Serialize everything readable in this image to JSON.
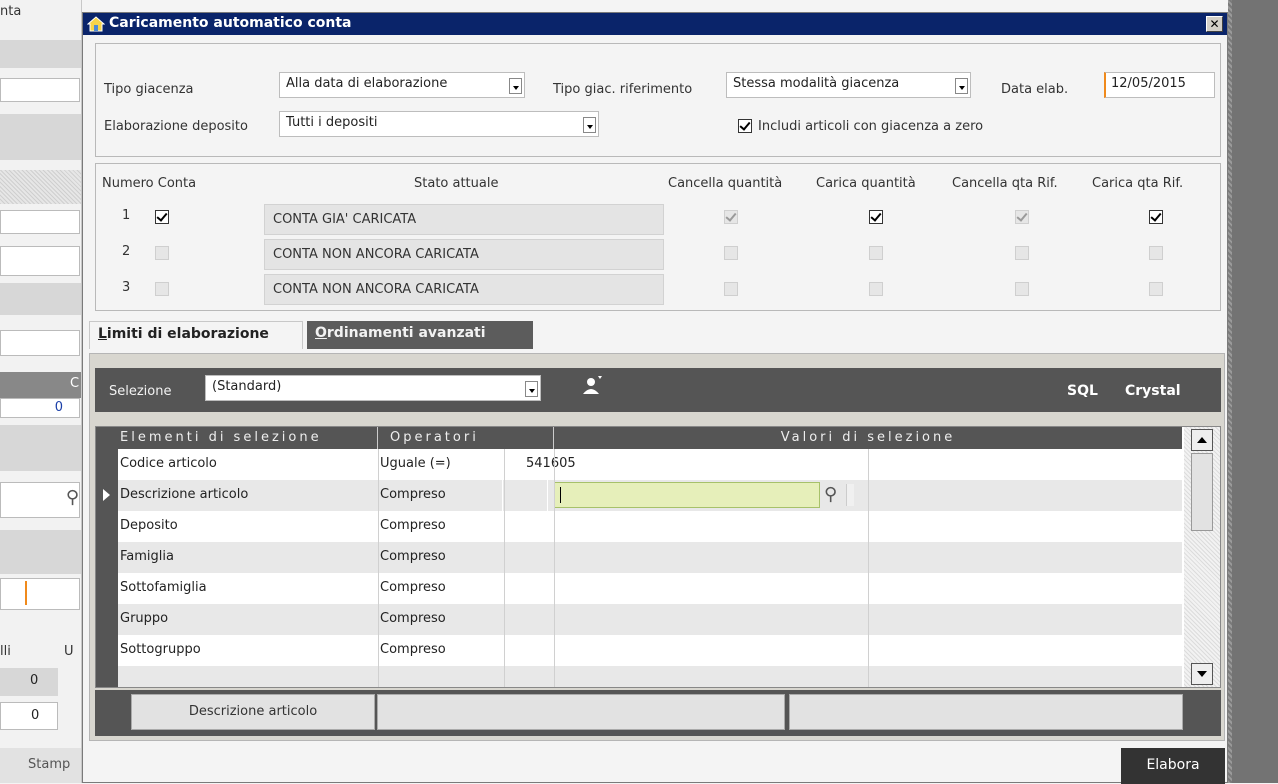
{
  "background": {
    "left_title_fragment": "nta",
    "left_value_zero": "0",
    "left_col_c": "C",
    "left_col_li": "lli",
    "left_col_u": "U",
    "row_zero_1": "0",
    "row_zero_2": "0",
    "stamp_label": "Stamp"
  },
  "dialog": {
    "title": "Caricamento automatico conta",
    "close_label": "✕",
    "close_icon": "close-icon",
    "app_icon": "home-icon"
  },
  "params": {
    "tipo_giacenza_label": "Tipo giacenza",
    "tipo_giacenza_value": "Alla data di elaborazione",
    "tipo_giac_rif_label": "Tipo giac. riferimento",
    "tipo_giac_rif_value": "Stessa modalità giacenza",
    "data_elab_label": "Data elab.",
    "data_elab_value": "12/05/2015",
    "elab_deposito_label": "Elaborazione deposito",
    "elab_deposito_value": "Tutti i depositi",
    "includi_label": "Includi articoli con giacenza a zero",
    "includi_checked": true
  },
  "conte": {
    "headers": {
      "numero": "Numero Conta",
      "stato": "Stato attuale",
      "cancella_qta": "Cancella quantità",
      "carica_qta": "Carica quantità",
      "cancella_rif": "Cancella qta Rif.",
      "carica_rif": "Carica qta Rif."
    },
    "rows": [
      {
        "num": "1",
        "state": "CONTA GIA' CARICATA"
      },
      {
        "num": "2",
        "state": "CONTA NON ANCORA CARICATA"
      },
      {
        "num": "3",
        "state": "CONTA NON ANCORA CARICATA"
      }
    ]
  },
  "tabs": [
    {
      "label_first": "L",
      "label_rest": "imiti di elaborazione"
    },
    {
      "label_first": "O",
      "label_rest": "rdinamenti avanzati"
    }
  ],
  "selection": {
    "label": "Selezione",
    "value": "(Standard)",
    "sql_label": "SQL",
    "crystal_label": "Crystal",
    "user_icon": "user-icon"
  },
  "grid": {
    "col_elementi": "Elementi di selezione",
    "col_operatori": "Operatori",
    "col_valori": "Valori di selezione",
    "rows": [
      {
        "elemento": "Codice articolo",
        "operatore": "Uguale (=)",
        "valore": "541605"
      },
      {
        "elemento": "Descrizione articolo",
        "operatore": "Compreso",
        "valore": ""
      },
      {
        "elemento": "Deposito",
        "operatore": "Compreso",
        "valore": ""
      },
      {
        "elemento": "Famiglia",
        "operatore": "Compreso",
        "valore": ""
      },
      {
        "elemento": "Sottofamiglia",
        "operatore": "Compreso",
        "valore": ""
      },
      {
        "elemento": "Gruppo",
        "operatore": "Compreso",
        "valore": ""
      },
      {
        "elemento": "Sottogruppo",
        "operatore": "Compreso",
        "valore": ""
      }
    ]
  },
  "footer": {
    "status_field": "Descrizione articolo",
    "elabora_label": "Elabora"
  }
}
